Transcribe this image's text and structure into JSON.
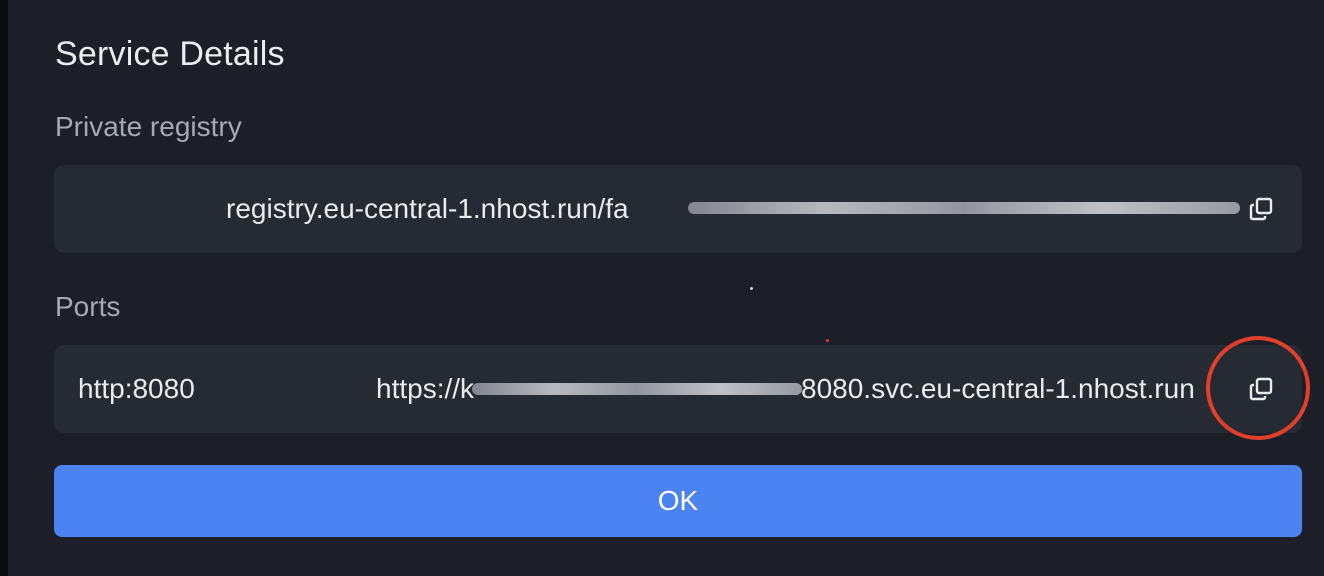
{
  "dialog": {
    "title": "Service Details"
  },
  "registry": {
    "label": "Private registry",
    "value": "registry.eu-central-1.nhost.run/fa",
    "copy_icon": "copy-icon"
  },
  "ports": {
    "label": "Ports",
    "items": [
      {
        "name": "http:8080",
        "url_prefix": "https://k",
        "url_suffix": "8080.svc.eu-central-1.nhost.run",
        "copy_icon": "copy-icon"
      }
    ]
  },
  "actions": {
    "ok_label": "OK"
  },
  "colors": {
    "dialog_background": "#1c1f27",
    "row_background": "#262a33",
    "primary_button": "#4b83f2",
    "annotation_red": "#e0402a"
  }
}
